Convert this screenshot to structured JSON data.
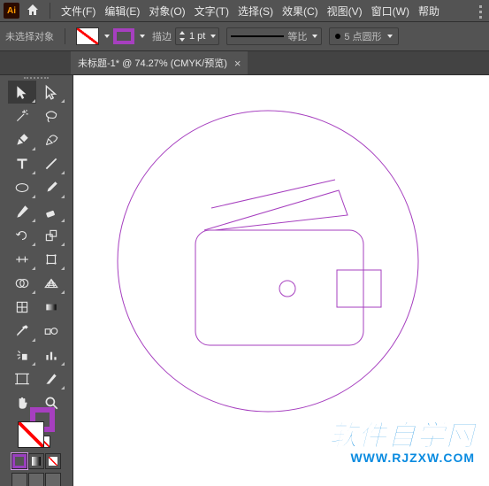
{
  "menubar": {
    "items": [
      "文件(F)",
      "编辑(E)",
      "对象(O)",
      "文字(T)",
      "选择(S)",
      "效果(C)",
      "视图(V)",
      "窗口(W)",
      "帮助"
    ]
  },
  "controlbar": {
    "selection_label": "未选择对象",
    "stroke_label": "描边",
    "stroke_value": "1 pt",
    "uniform_label": "等比",
    "brush_label": "5 点圆形"
  },
  "tabs": {
    "active_title": "未标题-1* @ 74.27% (CMYK/预览)"
  },
  "watermark": {
    "title": "软件自学网",
    "url": "WWW.RJZXW.COM"
  },
  "colors": {
    "stroke": "#a63fbf"
  }
}
